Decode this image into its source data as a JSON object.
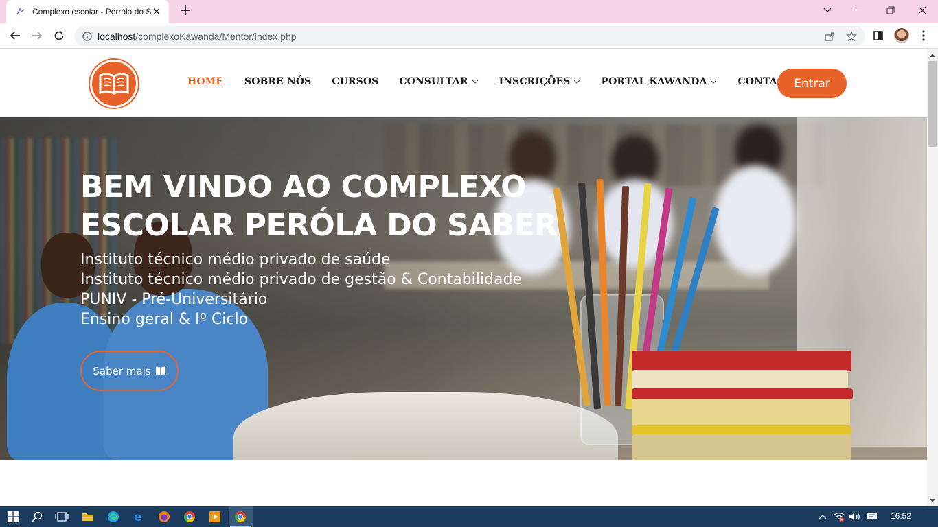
{
  "browser": {
    "tab_title": "Complexo escolar - Perróla do Sal",
    "url_host": "localhost",
    "url_path": "/complexoKawanda/Mentor/index.php"
  },
  "site": {
    "menu": [
      {
        "label": "HOME",
        "active": true,
        "dropdown": false
      },
      {
        "label": "SOBRE NÓS",
        "active": false,
        "dropdown": false
      },
      {
        "label": "CURSOS",
        "active": false,
        "dropdown": false
      },
      {
        "label": "CONSULTAR",
        "active": false,
        "dropdown": true
      },
      {
        "label": "INSCRIÇÕES",
        "active": false,
        "dropdown": true
      },
      {
        "label": "PORTAL KAWANDA",
        "active": false,
        "dropdown": true
      },
      {
        "label": "CONTACTO",
        "active": false,
        "dropdown": false
      }
    ],
    "login_label": "Entrar",
    "accent_color": "#e8632a"
  },
  "hero": {
    "title_line1": "BEM VINDO AO COMPLEXO",
    "title_line2": "ESCOLAR PERÓLA DO SABER",
    "lines": [
      "Instituto técnico médio privado de saúde",
      "Instituto técnico médio privado de gestão & Contabilidade",
      "PUNIV - Pré-Universitário",
      "Ensino geral & Iº Ciclo"
    ],
    "button_label": "Saber mais"
  },
  "taskbar": {
    "clock": "16:52"
  }
}
